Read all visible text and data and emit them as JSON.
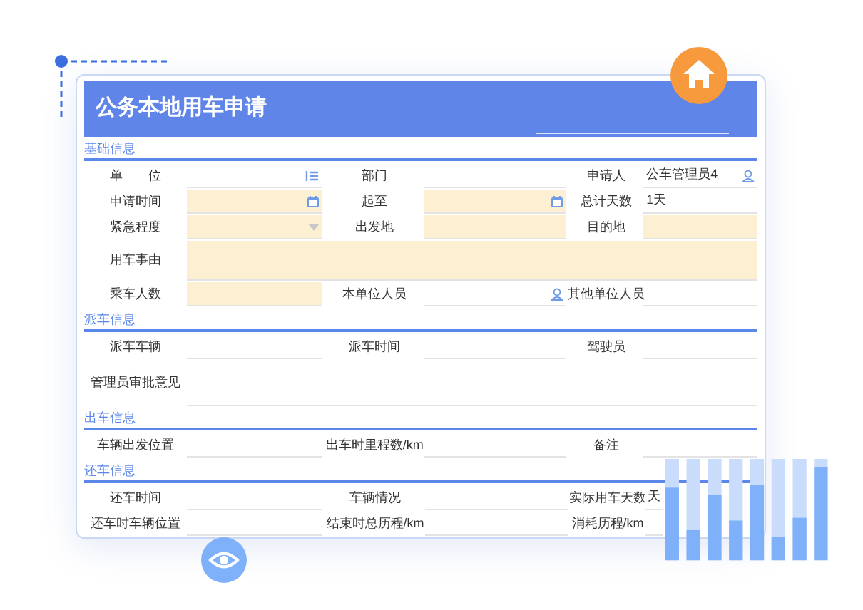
{
  "title": "公务本地用车申请",
  "sections": [
    {
      "title": "基础信息",
      "rows": [
        {
          "kind": "row",
          "cells": [
            {
              "label": "单　　位",
              "kind": "org",
              "required": false
            },
            {
              "label": "部门",
              "kind": "text",
              "required": false
            },
            {
              "label": "申请人",
              "kind": "person",
              "required": false,
              "value": "公车管理员4"
            }
          ]
        },
        {
          "kind": "row",
          "cells": [
            {
              "label": "申请时间",
              "kind": "date",
              "required": true
            },
            {
              "label": "起至",
              "kind": "date",
              "required": true
            },
            {
              "label": "总计天数",
              "kind": "text",
              "required": false,
              "value": "1天"
            }
          ]
        },
        {
          "kind": "row",
          "cells": [
            {
              "label": "紧急程度",
              "kind": "select",
              "required": true
            },
            {
              "label": "出发地",
              "kind": "text",
              "required": true
            },
            {
              "label": "目的地",
              "kind": "text",
              "required": true
            }
          ]
        },
        {
          "kind": "wide",
          "cells": [
            {
              "label": "用车事由",
              "kind": "text",
              "required": true
            }
          ]
        },
        {
          "kind": "row",
          "cells": [
            {
              "label": "乘车人数",
              "kind": "text",
              "required": true
            },
            {
              "label": "本单位人员",
              "kind": "person",
              "required": false
            },
            {
              "label": "其他单位人员",
              "kind": "text",
              "required": false
            }
          ]
        }
      ]
    },
    {
      "title": "派车信息",
      "rows": [
        {
          "kind": "row",
          "cells": [
            {
              "label": "派车车辆",
              "kind": "text",
              "required": false
            },
            {
              "label": "派车时间",
              "kind": "text",
              "required": false
            },
            {
              "label": "驾驶员",
              "kind": "text",
              "required": false
            }
          ]
        },
        {
          "kind": "wide",
          "cells": [
            {
              "label": "管理员审批意见",
              "kind": "text",
              "required": false
            }
          ]
        }
      ]
    },
    {
      "title": "出车信息",
      "rows": [
        {
          "kind": "row",
          "cells": [
            {
              "label": "车辆出发位置",
              "kind": "text",
              "required": false
            },
            {
              "label": "出车时里程数/km",
              "kind": "text",
              "required": false
            },
            {
              "label": "备注",
              "kind": "text",
              "required": false
            }
          ]
        }
      ]
    },
    {
      "title": "还车信息",
      "rows": [
        {
          "kind": "row",
          "cells": [
            {
              "label": "还车时间",
              "kind": "text",
              "required": false
            },
            {
              "label": "车辆情况",
              "kind": "text",
              "required": false
            },
            {
              "label": "实际用车天数",
              "kind": "text",
              "required": false,
              "value": "天"
            }
          ]
        },
        {
          "kind": "row",
          "cells": [
            {
              "label": "还车时车辆位置",
              "kind": "text",
              "required": false
            },
            {
              "label": "结束时总历程/km",
              "kind": "text",
              "required": false
            },
            {
              "label": "消耗历程/km",
              "kind": "text",
              "required": false
            }
          ]
        }
      ]
    }
  ]
}
